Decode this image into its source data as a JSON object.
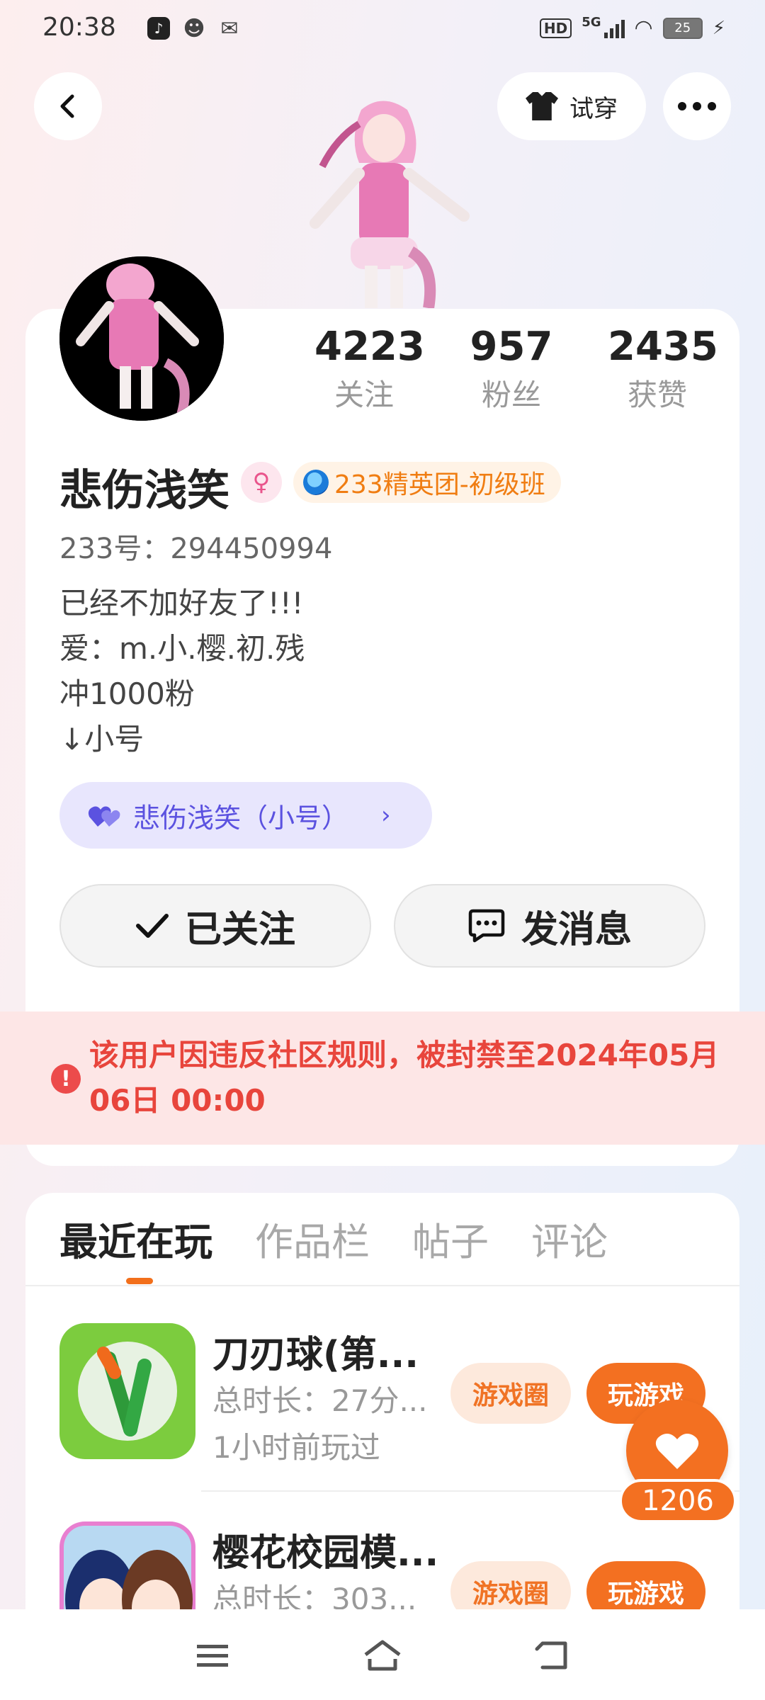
{
  "status_bar": {
    "time": "20:38",
    "apps": [
      "tiktok-icon",
      "face-icon",
      "wechat-icon"
    ],
    "hd": "HD",
    "network": "5G",
    "battery": "25"
  },
  "header": {
    "try_on_label": "试穿"
  },
  "profile": {
    "stats": [
      {
        "num": "4223",
        "label": "关注"
      },
      {
        "num": "957",
        "label": "粉丝"
      },
      {
        "num": "2435",
        "label": "获赞"
      }
    ],
    "nickname": "悲伤浅笑",
    "gender_symbol": "♀",
    "badge": "233精英团-初级班",
    "uid": "233号：294450994",
    "bio": [
      "已经不加好友了!!!",
      "爱：m.小.樱.初.残",
      "冲1000粉",
      "↓小号"
    ],
    "alt_account": "悲伤浅笑（小号）",
    "follow_label": "已关注",
    "message_label": "发消息"
  },
  "ban_notice": "该用户因违反社区规则，被封禁至2024年05月06日 00:00",
  "tabs": [
    "最近在玩",
    "作品栏",
    "帖子",
    "评论"
  ],
  "games": [
    {
      "title": "刀刃球(第...",
      "duration": "总时长：27分...",
      "last_played": "1小时前玩过",
      "circle_label": "游戏圈",
      "play_label": "玩游戏"
    },
    {
      "title": "樱花校园模...",
      "duration": "总时长：303...",
      "last_played": "",
      "circle_label": "游戏圈",
      "play_label": "玩游戏"
    }
  ],
  "like_count": "1206",
  "colors": {
    "accent": "#f37021",
    "ban_red": "#e8453c",
    "alt_purple": "#5b52e0"
  }
}
